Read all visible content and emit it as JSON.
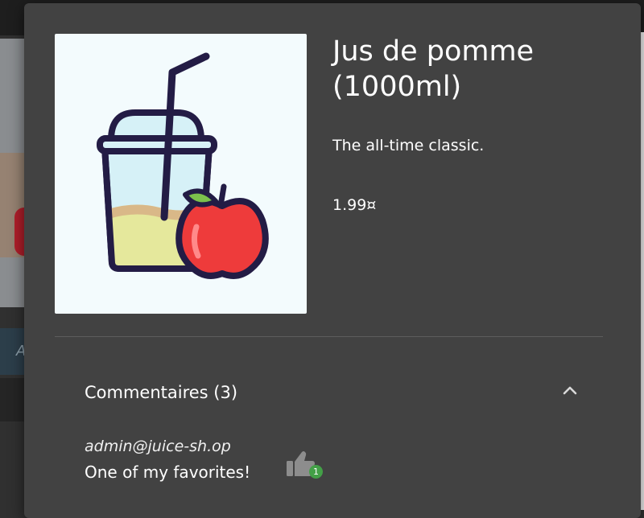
{
  "background": {
    "footer_fragment": "A"
  },
  "product": {
    "title": "Jus de pomme (1000ml)",
    "description": "The all-time classic.",
    "price": "1.99¤",
    "image_icon": "apple-juice-cup-with-straw-and-apple-illustration"
  },
  "reviews": {
    "header_label": "Commentaires (3)",
    "expanded": true,
    "toggle_icon": "chevron-up-icon",
    "items": [
      {
        "author": "admin@juice-sh.op",
        "text": "One of my favorites!",
        "like_icon": "thumb-up-icon",
        "likes": "1"
      }
    ]
  },
  "colors": {
    "dialog_background": "#424242",
    "page_background": "#303030",
    "image_background": "#f3fbfd",
    "like_badge": "#43a047"
  }
}
